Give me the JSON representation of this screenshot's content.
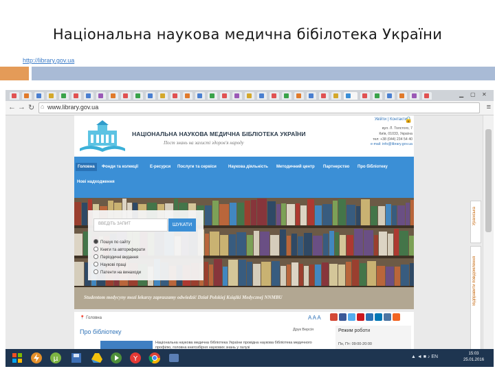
{
  "slide": {
    "title": "Національна наукова медична бібілотека України",
    "link": "http://library.gov.ua"
  },
  "browser": {
    "address": "www.library.gov.ua",
    "address_prefix": "⌂"
  },
  "site": {
    "name": "НАЦІОНАЛЬНА НАУКОВА МЕДИЧНА БІБЛІОТЕКА УКРАЇНИ",
    "slogan": "Пост знань на захисті здоров'я народу",
    "top_links": "Увійти  |  Контакти",
    "contacts": [
      "вул. Л. Толстого, 7",
      "Київ, 01033, Україна",
      "тел: +38 (044) 234 54 40",
      "e-mail: info@library.gov.ua"
    ],
    "menu": [
      "Головна",
      "Фонди та колекції",
      "Е-ресурси",
      "Послуги та сервіси",
      "Наукова діяльність",
      "Методичний центр",
      "Партнерство",
      "Про бібліотеку"
    ],
    "menu_sub": "Нові надходження",
    "search": {
      "placeholder": "ВВЕДІТЬ ЗАПИТ",
      "button": "ШУКАТИ",
      "options": [
        "Пошук по сайту",
        "Книги та автореферати",
        "Періодичні видання",
        "Наукові праці",
        "Патенти на винаходи"
      ]
    },
    "banner": "Studentom medycyny mozi lekarzy zapraszamy odwiedzić Dział Polskiej Książki Medycznej NNMBU",
    "breadcrumb": "Головна",
    "font_size": "A A A",
    "page_heading": "Про бібліотеку",
    "tools": "Друк   Версія",
    "mode_title": "Режим роботи",
    "mode_text": "Пн, Пт:  09:00-20:00",
    "body_text": "Національна наукова медична бібліотека України провідна наукова бібліотека медичного профілю, головна книгозбірня наукових знань у галузі",
    "side_tab1": "Ураїнська",
    "side_tab2": "Відправити повідомлення"
  },
  "taskbar": {
    "tray": "▲ ◄ ■ ♪ EN",
    "clock_time": "15:03",
    "clock_date": "25.01.2016"
  }
}
